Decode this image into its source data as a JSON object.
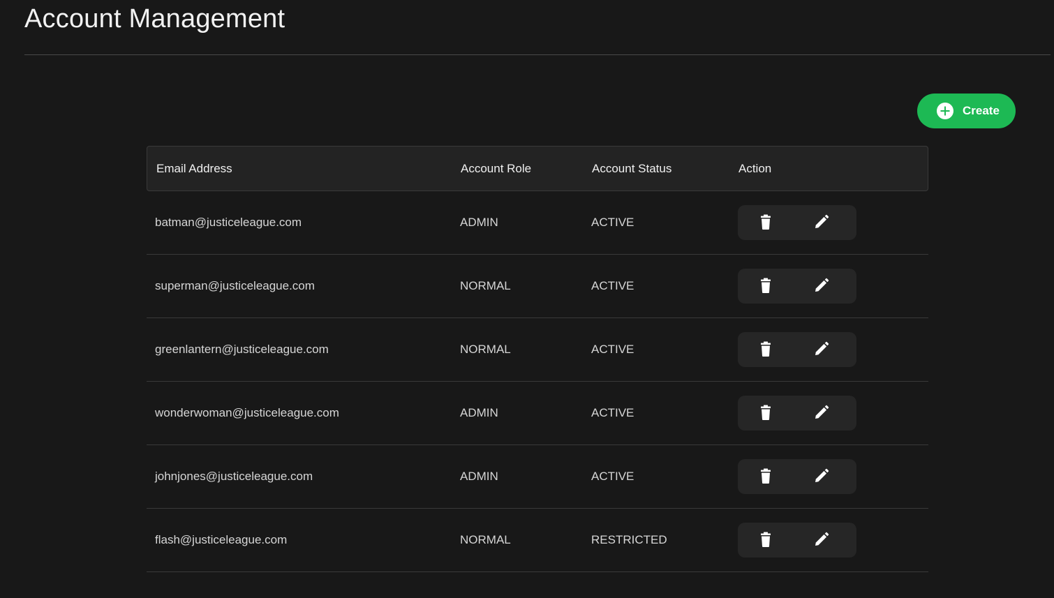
{
  "header": {
    "title": "Account Management"
  },
  "toolbar": {
    "create_label": "Create",
    "create_icon": "plus-circle-icon",
    "accent_color": "#1db954"
  },
  "table": {
    "columns": {
      "email": "Email Address",
      "role": "Account Role",
      "status": "Account Status",
      "action": "Action"
    },
    "rows": [
      {
        "email": "batman@justiceleague.com",
        "role": "ADMIN",
        "status": "ACTIVE"
      },
      {
        "email": "superman@justiceleague.com",
        "role": "NORMAL",
        "status": "ACTIVE"
      },
      {
        "email": "greenlantern@justiceleague.com",
        "role": "NORMAL",
        "status": "ACTIVE"
      },
      {
        "email": "wonderwoman@justiceleague.com",
        "role": "ADMIN",
        "status": "ACTIVE"
      },
      {
        "email": "johnjones@justiceleague.com",
        "role": "ADMIN",
        "status": "ACTIVE"
      },
      {
        "email": "flash@justiceleague.com",
        "role": "NORMAL",
        "status": "RESTRICTED"
      }
    ],
    "row_actions": [
      "trash-icon",
      "pencil-icon"
    ]
  }
}
